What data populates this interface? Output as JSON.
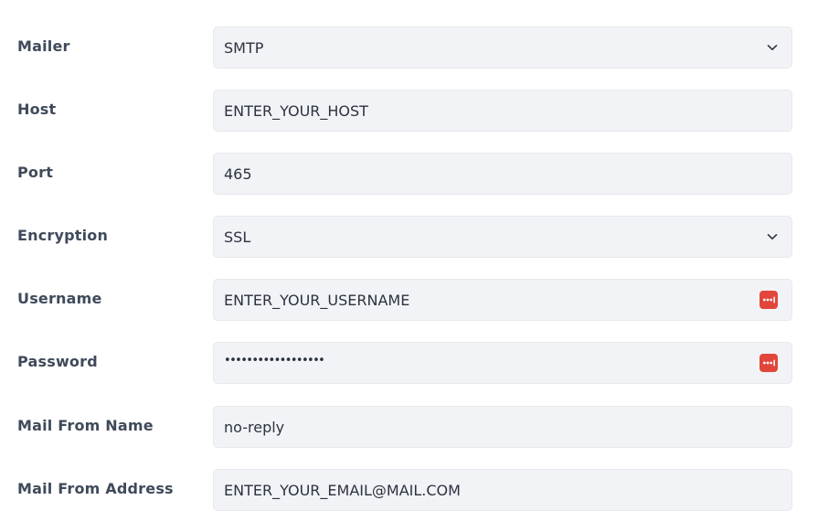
{
  "mailer": {
    "label": "Mailer",
    "value": "SMTP"
  },
  "host": {
    "label": "Host",
    "value": "ENTER_YOUR_HOST"
  },
  "port": {
    "label": "Port",
    "value": "465"
  },
  "encryption": {
    "label": "Encryption",
    "value": "SSL"
  },
  "username": {
    "label": "Username",
    "value": "ENTER_YOUR_USERNAME",
    "icon": "password-manager-icon"
  },
  "password": {
    "label": "Password",
    "masked_value": "••••••••••••••••••",
    "icon": "password-manager-icon"
  },
  "mail_from_name": {
    "label": "Mail From Name",
    "value": "no-reply"
  },
  "mail_from_address": {
    "label": "Mail From Address",
    "value": "ENTER_YOUR_EMAIL@MAIL.COM"
  },
  "colors": {
    "field_background": "#f2f3f6",
    "label_text": "#3f4a5a",
    "value_text": "#2b3340",
    "password_manager_icon": "#e2463a"
  }
}
